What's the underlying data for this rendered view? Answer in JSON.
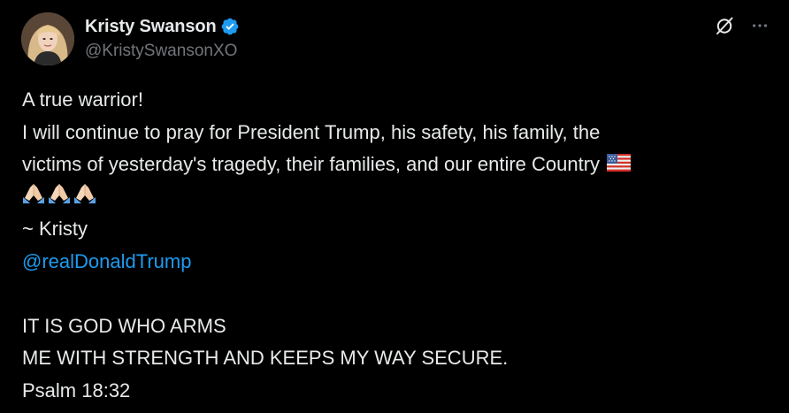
{
  "author": {
    "display_name": "Kristy Swanson",
    "handle": "@KristySwansonXO",
    "verified": true,
    "avatar_icon": "profile-photo"
  },
  "actions": {
    "grok_icon": "slashed-circle-icon",
    "more_icon": "more-dots-icon"
  },
  "tweet": {
    "line1": "A true warrior!",
    "line2": "I will continue to pray for President Trump, his safety, his family, the",
    "line3": "victims of yesterday's tragedy, their families, and our entire Country",
    "line3_emoji": "us-flag",
    "line4_emoji": [
      "folded-hands",
      "folded-hands",
      "folded-hands"
    ],
    "line5": "~ Kristy",
    "mention": "@realDonaldTrump",
    "line7": "IT IS GOD WHO ARMS",
    "line8": "ME WITH STRENGTH AND KEEPS MY WAY SECURE.",
    "line9": "Psalm 18:32"
  },
  "colors": {
    "background": "#000000",
    "text": "#e7e9ea",
    "secondary": "#71767b",
    "link": "#1d9bf0",
    "verified": "#1d9bf0"
  }
}
